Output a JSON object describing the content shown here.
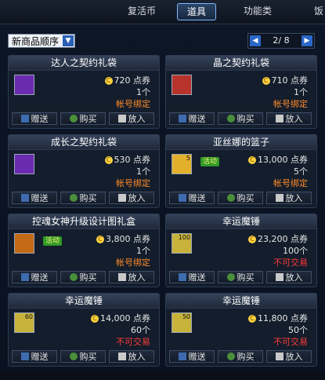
{
  "tabs": {
    "t1": "复活币",
    "t2": "道具",
    "t3": "功能类",
    "t4": "饭"
  },
  "sort": {
    "label": "新商品顺序",
    "page_text": "2/ 8"
  },
  "actions": {
    "gift": "赠送",
    "buy": "购买",
    "put": "放入"
  },
  "cards": [
    {
      "title": "达人之契约礼袋",
      "price": "720",
      "unit": "点券",
      "qty": "1个",
      "tag": "帐号绑定",
      "tag_color": "#ff8a2a",
      "badge": ""
    },
    {
      "title": "晶之契约礼袋",
      "price": "710",
      "unit": "点券",
      "qty": "1个",
      "tag": "帐号绑定",
      "tag_color": "#ff8a2a",
      "badge": ""
    },
    {
      "title": "成长之契约礼袋",
      "price": "530",
      "unit": "点券",
      "qty": "1个",
      "tag": "帐号绑定",
      "tag_color": "#ff8a2a",
      "badge": ""
    },
    {
      "title": "亚丝娜的篮子",
      "price": "13,000",
      "unit": "点券",
      "qty": "5个",
      "tag": "帐号绑定",
      "tag_color": "#ff8a2a",
      "badge": "活动",
      "thumb_num": "5"
    },
    {
      "title": "控魂女神升级设计图礼盒",
      "price": "3,800",
      "unit": "点券",
      "qty": "1个",
      "tag": "帐号绑定",
      "tag_color": "#ff8a2a",
      "badge": "活动"
    },
    {
      "title": "幸运魔锤",
      "price": "23,200",
      "unit": "点券",
      "qty": "100个",
      "tag": "不可交易",
      "tag_color": "#ff3a3a",
      "badge": "",
      "thumb_num": "100"
    },
    {
      "title": "幸运魔锤",
      "price": "14,000",
      "unit": "点券",
      "qty": "60个",
      "tag": "不可交易",
      "tag_color": "#ff3a3a",
      "badge": "",
      "thumb_num": "60"
    },
    {
      "title": "幸运魔锤",
      "price": "11,800",
      "unit": "点券",
      "qty": "50个",
      "tag": "不可交易",
      "tag_color": "#ff3a3a",
      "badge": "",
      "thumb_num": "50"
    }
  ]
}
